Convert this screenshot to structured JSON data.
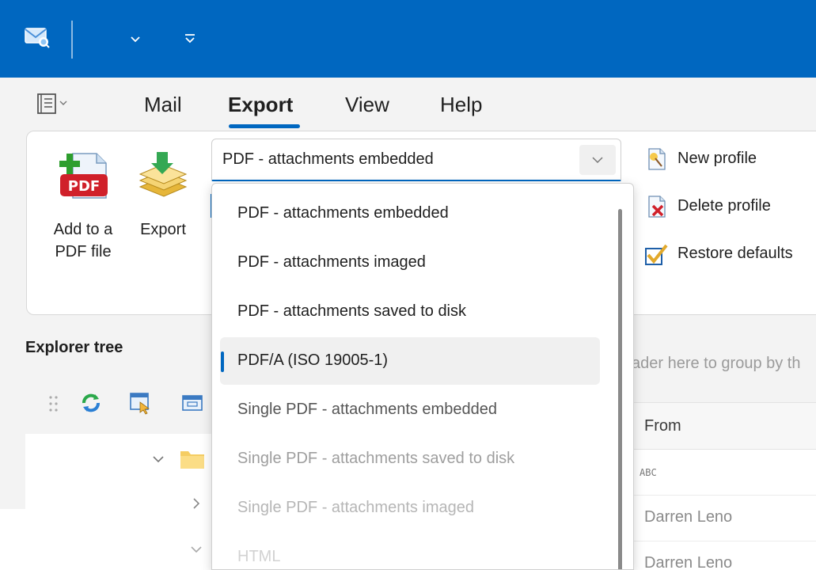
{
  "ribbon": {
    "tabs": [
      {
        "label": "Mail"
      },
      {
        "label": "Export"
      },
      {
        "label": "View"
      },
      {
        "label": "Help"
      }
    ],
    "active_tab": "Export",
    "buttons": {
      "add_to_pdf": {
        "line1": "Add to a",
        "line2": "PDF file"
      },
      "export": {
        "label": "Export"
      }
    },
    "profile_combo": {
      "value": "PDF - attachments embedded"
    },
    "commands": {
      "new_profile": "New profile",
      "delete_profile": "Delete profile",
      "restore_defaults": "Restore defaults"
    },
    "pdf_icon_text": "PDF"
  },
  "dropdown": {
    "items": [
      {
        "label": "PDF - attachments embedded"
      },
      {
        "label": "PDF - attachments imaged"
      },
      {
        "label": "PDF - attachments saved to disk"
      },
      {
        "label": "PDF/A (ISO 19005-1)",
        "selected": true
      },
      {
        "label": "Single PDF - attachments embedded"
      },
      {
        "label": "Single PDF - attachments saved to disk"
      },
      {
        "label": "Single PDF - attachments imaged"
      },
      {
        "label": "HTML"
      }
    ]
  },
  "explorer": {
    "title": "Explorer tree"
  },
  "grid": {
    "group_hint": "ader here to group by th",
    "columns": [
      {
        "label": "From"
      }
    ],
    "rows": [
      {
        "from": "ABC"
      },
      {
        "from": "Darren Leno"
      },
      {
        "from": "Darren Leno"
      }
    ]
  },
  "colors": {
    "accent": "#0067c0",
    "ribbon_bg": "#f3f3f3"
  }
}
